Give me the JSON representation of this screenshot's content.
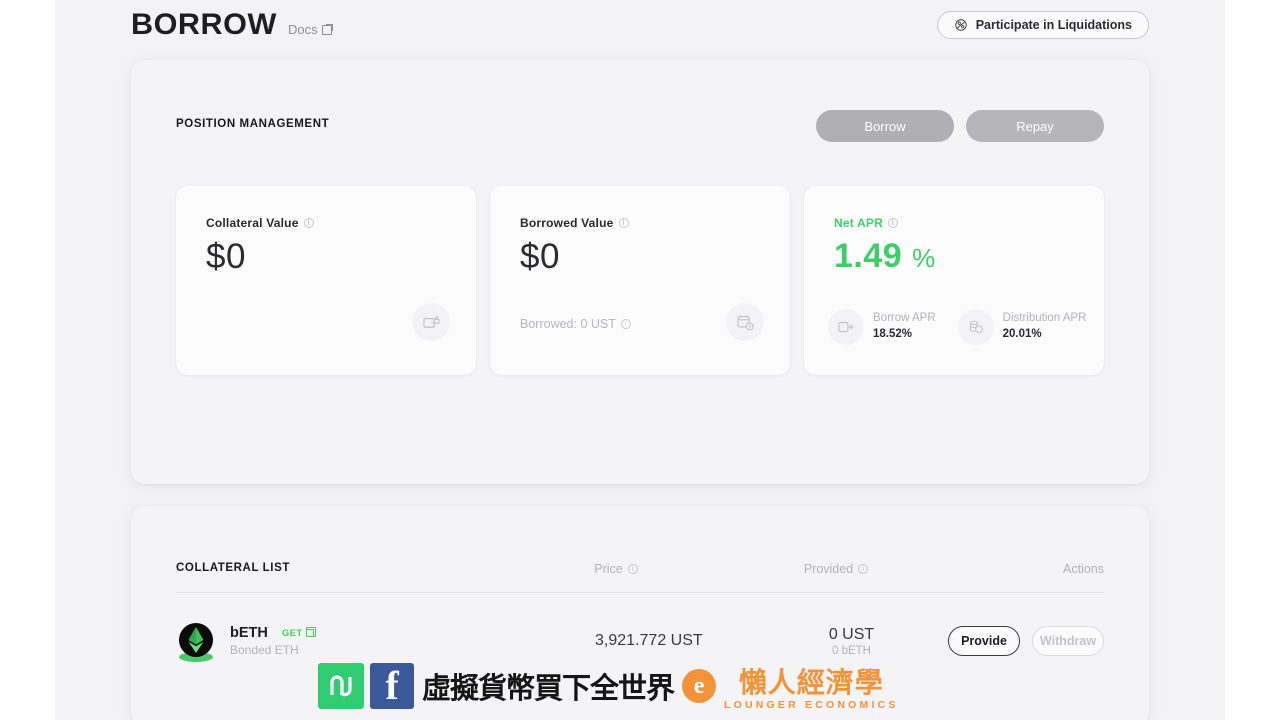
{
  "header": {
    "brand": "BORROW",
    "docs_label": "Docs",
    "docs_icon": "external-link-icon",
    "liquidations_button": "Participate in Liquidations",
    "liquidations_icon": "liquidation-icon"
  },
  "position_section": {
    "title": "POSITION MANAGEMENT",
    "tabs": [
      {
        "label": "Borrow",
        "active": true
      },
      {
        "label": "Repay",
        "active": false
      }
    ],
    "cards": [
      {
        "label": "Collateral Value",
        "info_icon": "info-icon",
        "value": "$0",
        "sub": "",
        "icon": "wallet-lock-icon"
      },
      {
        "label": "Borrowed Value",
        "info_icon": "info-icon",
        "value": "$0",
        "sub": "Borrowed: 0 UST",
        "icon": "calendar-clock-icon"
      },
      {
        "label": "Net APR",
        "info_icon": "info-icon",
        "value": "1.49",
        "unit": "%",
        "accent": "#3ece68",
        "metrics": [
          {
            "name": "Borrow APR",
            "value": "18.52%",
            "icon": "wallet-out-icon"
          },
          {
            "name": "Distribution APR",
            "value": "20.01%",
            "icon": "coins-stack-icon"
          }
        ]
      }
    ]
  },
  "collateral_section": {
    "title": "COLLATERAL LIST",
    "columns": {
      "price": "Price",
      "provided": "Provided",
      "actions": "Actions"
    },
    "rows": [
      {
        "symbol": "bETH",
        "get_label": "GET",
        "get_icon": "external-link-icon",
        "name": "Bonded ETH",
        "token_icon": "beth-token-icon",
        "price": "3,921.772 UST",
        "provided_main": "0 UST",
        "provided_sub": "0 bETH",
        "provide_label": "Provide",
        "withdraw_label": "Withdraw"
      }
    ]
  },
  "watermark": {
    "cn_text": "虛擬貨幣買下全世界",
    "brand_cn": "懶人經濟學",
    "brand_en": "LOUNGER ECONOMICS",
    "fb_glyph": "f",
    "orange_glyph": "e"
  }
}
